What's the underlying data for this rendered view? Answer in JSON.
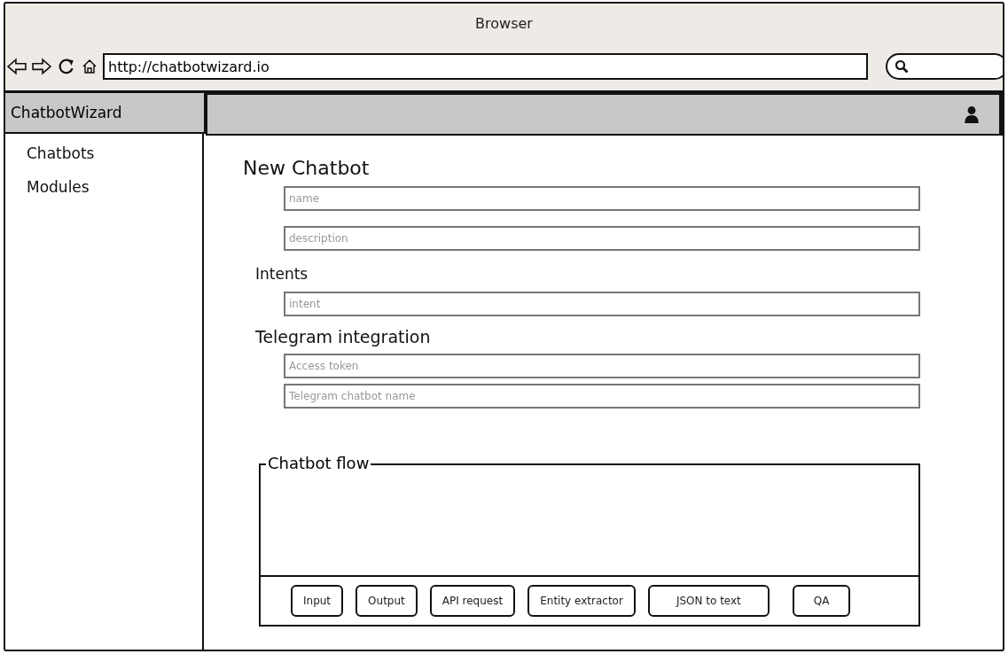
{
  "window": {
    "title": "Browser"
  },
  "address_bar": {
    "value": "http://chatbotwizard.io"
  },
  "app": {
    "name": "ChatbotWizard"
  },
  "sidebar": {
    "items": [
      {
        "label": "Chatbots"
      },
      {
        "label": "Modules"
      }
    ]
  },
  "form": {
    "title": "New Chatbot",
    "sections": [
      {
        "fields": [
          {
            "placeholder": "name"
          },
          {
            "placeholder": "description"
          }
        ]
      },
      {
        "heading": "Intents",
        "fields": [
          {
            "placeholder": "intent"
          }
        ]
      },
      {
        "heading": "Telegram integration",
        "fields": [
          {
            "placeholder": "Access token"
          },
          {
            "placeholder": "Telegram chatbot name"
          }
        ]
      }
    ]
  },
  "flow": {
    "title": "Chatbot flow",
    "modules": [
      "Input",
      "Output",
      "API request",
      "Entity extractor",
      "JSON to text",
      "QA"
    ]
  }
}
